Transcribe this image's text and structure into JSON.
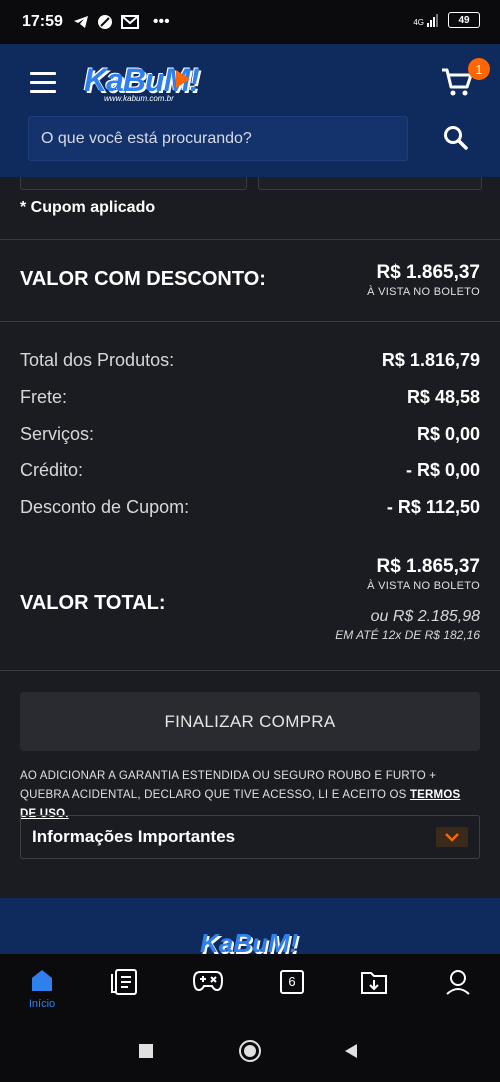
{
  "status_bar": {
    "time": "17:59",
    "network": "4G",
    "battery": "49"
  },
  "header": {
    "logo": "KaBuM!",
    "logo_sub": "www.kabum.com.br",
    "cart_count": "1",
    "search_placeholder": "O que você está procurando?"
  },
  "coupon_note": "* Cupom aplicado",
  "discount_value": {
    "label": "VALOR COM DESCONTO:",
    "price": "R$ 1.865,37",
    "note": "À VISTA NO BOLETO"
  },
  "summary": [
    {
      "label": "Total dos Produtos:",
      "value": "R$ 1.816,79"
    },
    {
      "label": "Frete:",
      "value": "R$ 48,58"
    },
    {
      "label": "Serviços:",
      "value": "R$ 0,00"
    },
    {
      "label": "Crédito:",
      "value": "- R$ 0,00"
    },
    {
      "label": "Desconto de Cupom:",
      "value": "- R$ 112,50"
    }
  ],
  "total": {
    "label": "VALOR TOTAL:",
    "price": "R$ 1.865,37",
    "note": "À VISTA NO BOLETO",
    "installment": "ou R$ 2.185,98",
    "installment_detail": "EM ATÉ 12x DE R$ 182,16"
  },
  "checkout_button": "FINALIZAR COMPRA",
  "disclaimer": {
    "text": "AO ADICIONAR A GARANTIA ESTENDIDA OU SEGURO ROUBO E FURTO + QUEBRA ACIDENTAL, DECLARO QUE TIVE ACESSO, LI E ACEITO OS",
    "link": "TERMOS DE USO."
  },
  "info_accordion": "Informações Importantes",
  "footer_logo": "KaBuM!",
  "bottom_nav": {
    "home_label": "Início",
    "coupon_number": "6"
  },
  "colors": {
    "header_bg": "#0f2a5c",
    "accent_orange": "#ff6500",
    "brand_blue": "#2f80ed",
    "page_bg": "#1b1c21"
  }
}
